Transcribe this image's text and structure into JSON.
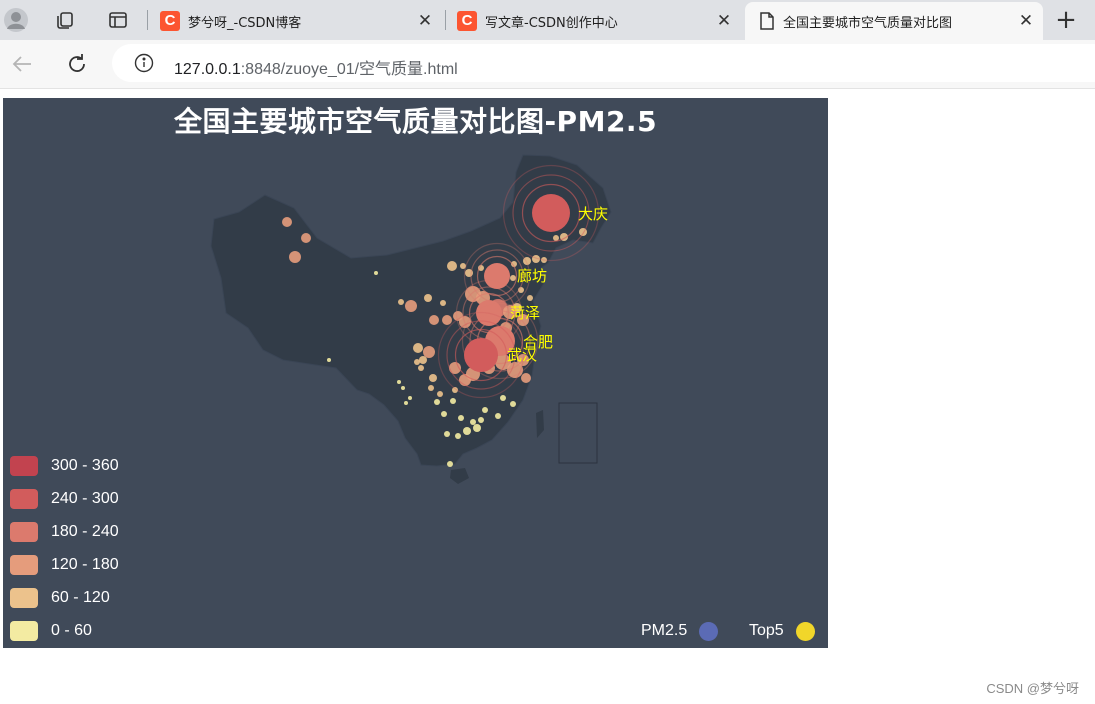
{
  "browser": {
    "tabs": [
      {
        "title": "梦兮呀_-CSDN博客",
        "icon": "csdn-icon",
        "active": false
      },
      {
        "title": "写文章-CSDN创作中心",
        "icon": "csdn-icon",
        "active": false
      },
      {
        "title": "全国主要城市空气质量对比图",
        "icon": "document-icon",
        "active": true
      }
    ],
    "close_glyph": "✕",
    "new_tab_glyph": "+",
    "csdn_glyph": "C",
    "url_host": "127.0.0.1",
    "url_path": ":8848/zuoye_01/空气质量.html"
  },
  "chart": {
    "title": "全国主要城市空气质量对比图-PM2.5",
    "colors": {
      "background": "#404a59",
      "top5_label": "#ffff00",
      "pm25_series": "#5b6bb5",
      "top5_series": "#f1d62a"
    },
    "visual_map": [
      {
        "label": "300 - 360",
        "color": "#c2434f"
      },
      {
        "label": "240 - 300",
        "color": "#d25c5c"
      },
      {
        "label": "180 - 240",
        "color": "#dc7a6d"
      },
      {
        "label": "120 - 180",
        "color": "#e59c7c"
      },
      {
        "label": "60 - 120",
        "color": "#ecc28c"
      },
      {
        "label": "0 - 60",
        "color": "#f3eba2"
      }
    ],
    "series_legend": [
      {
        "name": "PM2.5",
        "color": "#5b6bb5"
      },
      {
        "name": "Top5",
        "color": "#f1d62a"
      }
    ],
    "top5_labels": [
      "大庆",
      "廊坊",
      "菏泽",
      "合肥",
      "武汉"
    ]
  },
  "chart_data": {
    "type": "scatter",
    "title": "全国主要城市空气质量对比图-PM2.5",
    "visual_map_ranges": [
      [
        300,
        360
      ],
      [
        240,
        300
      ],
      [
        180,
        240
      ],
      [
        120,
        180
      ],
      [
        60,
        120
      ],
      [
        0,
        60
      ]
    ],
    "series": [
      {
        "name": "Top5",
        "points": [
          {
            "name": "大庆",
            "value": 279
          },
          {
            "name": "廊坊",
            "value": 193
          },
          {
            "name": "菏泽",
            "value": 194
          },
          {
            "name": "合肥",
            "value": 229
          },
          {
            "name": "武汉",
            "value": 273
          }
        ]
      },
      {
        "name": "PM2.5",
        "points": []
      }
    ]
  },
  "footer": {
    "watermark": "CSDN @梦兮呀"
  }
}
